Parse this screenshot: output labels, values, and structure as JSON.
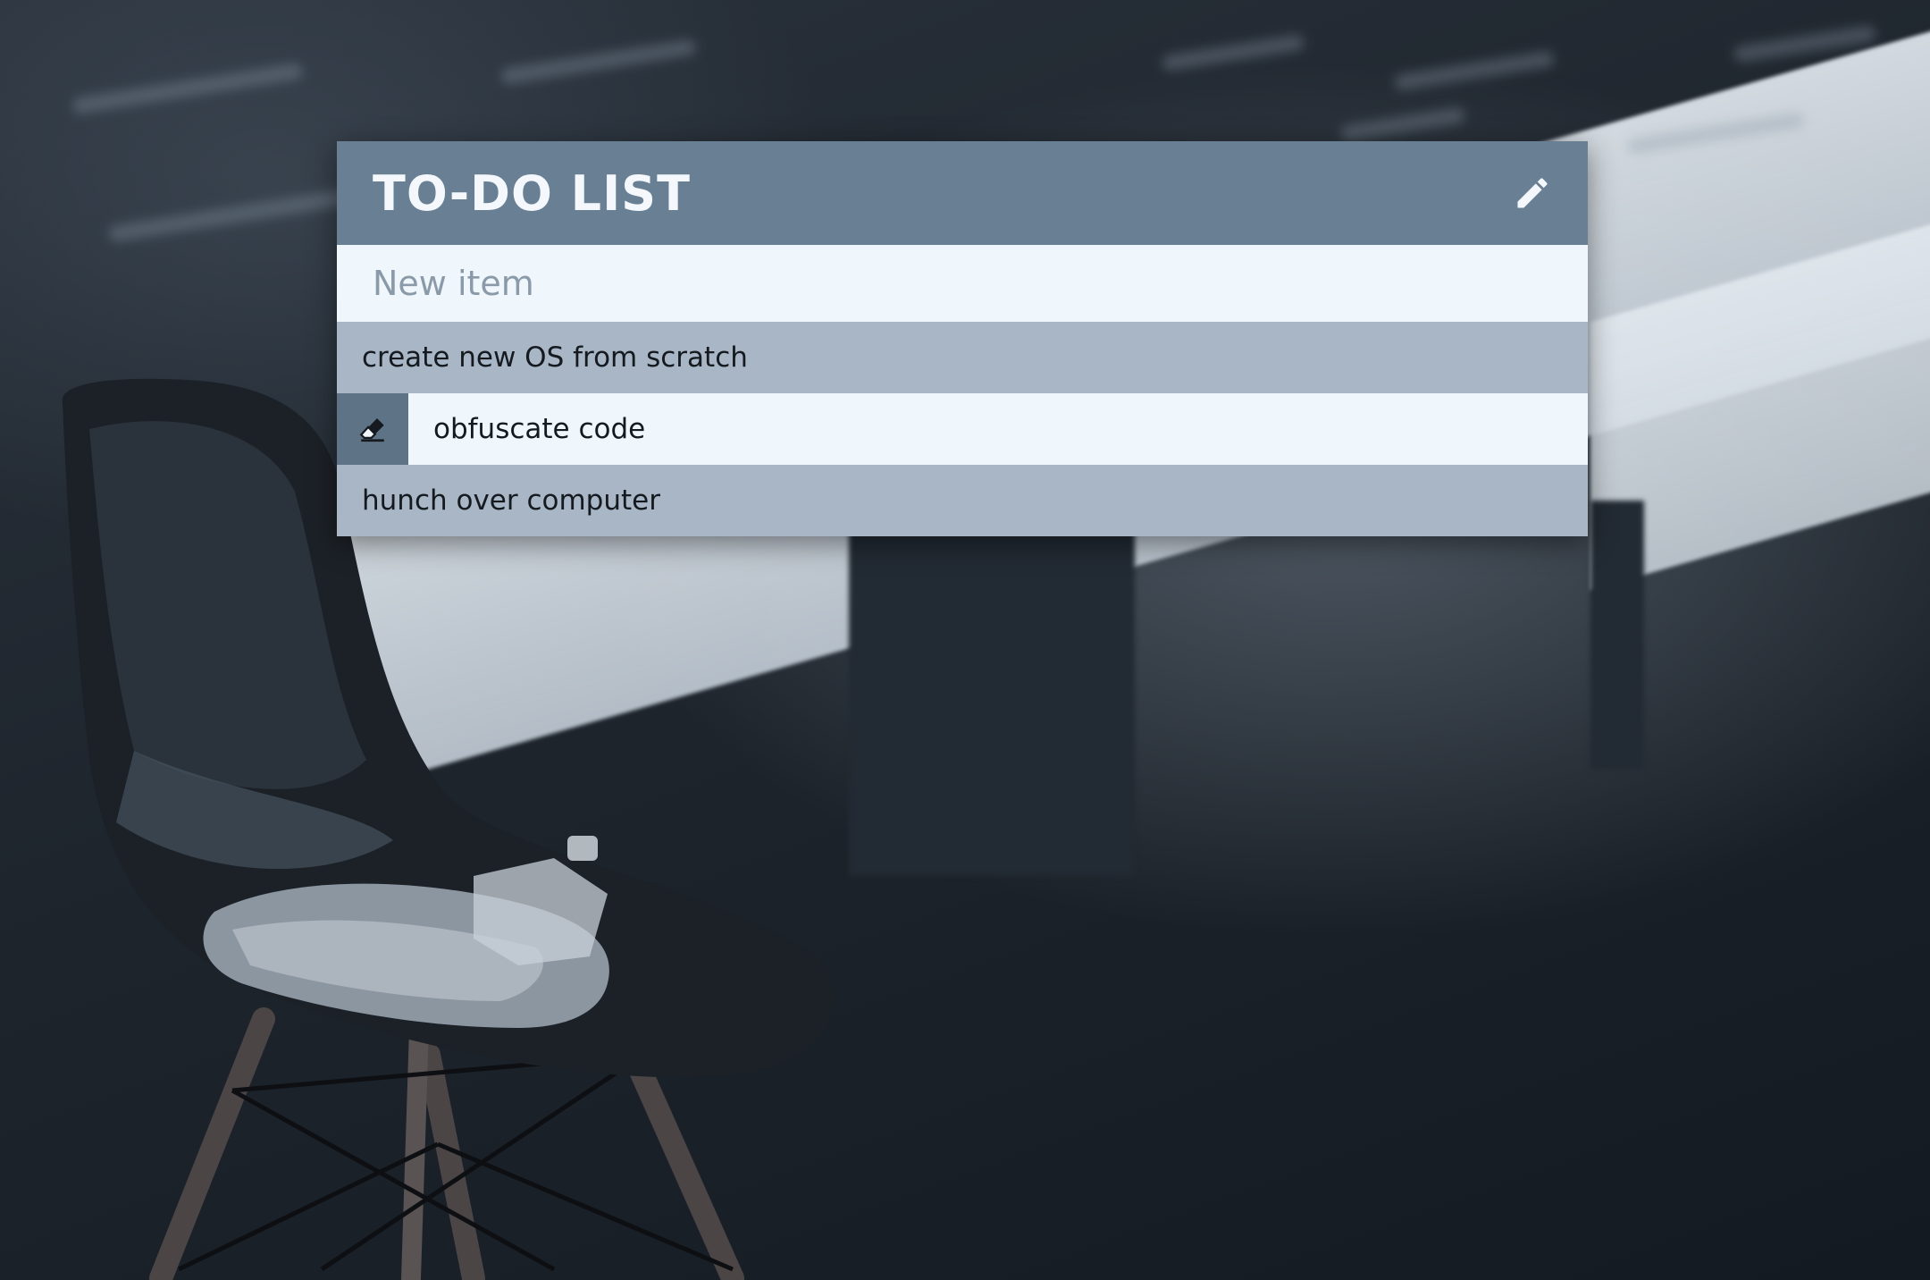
{
  "widget": {
    "title": "TO-DO LIST",
    "edit_icon": "pencil-icon"
  },
  "new_item": {
    "placeholder": "New item",
    "value": ""
  },
  "items": [
    {
      "label": "create new OS from scratch"
    },
    {
      "label": "obfuscate code",
      "hover_icon": "eraser-icon"
    },
    {
      "label": "hunch over computer"
    }
  ],
  "colors": {
    "header": "#697f93",
    "input_bg": "#eff7fd",
    "row_alt": "#a9b6c6",
    "delete_bg": "#5f7387"
  }
}
